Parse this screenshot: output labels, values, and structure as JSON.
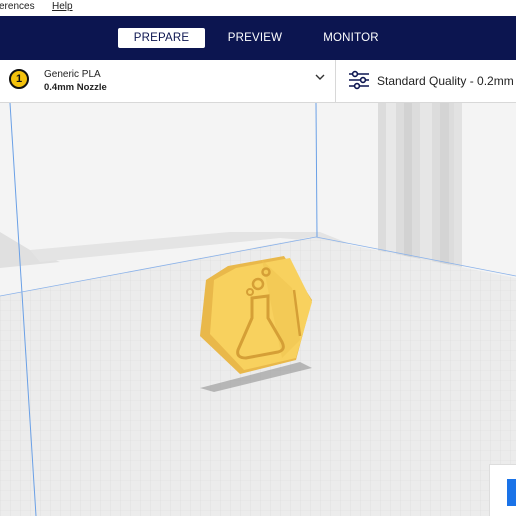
{
  "menu": {
    "preferences": "erences",
    "help": "Help"
  },
  "stages": {
    "prepare": "PREPARE",
    "preview": "PREVIEW",
    "monitor": "MONITOR"
  },
  "extruder": {
    "number": "1",
    "material": "Generic PLA",
    "nozzle": "0.4mm Nozzle"
  },
  "print_settings": {
    "quality": "Standard Quality - 0.2mm"
  },
  "colors": {
    "header_bg": "#0c1550",
    "model_fill": "#f8d15e",
    "accent_blue": "#1a73e8",
    "extruder_yellow": "#f4c20d"
  },
  "icons": [
    "chevron-down-icon",
    "settings-sliders-icon",
    "extruder-badge-icon"
  ]
}
